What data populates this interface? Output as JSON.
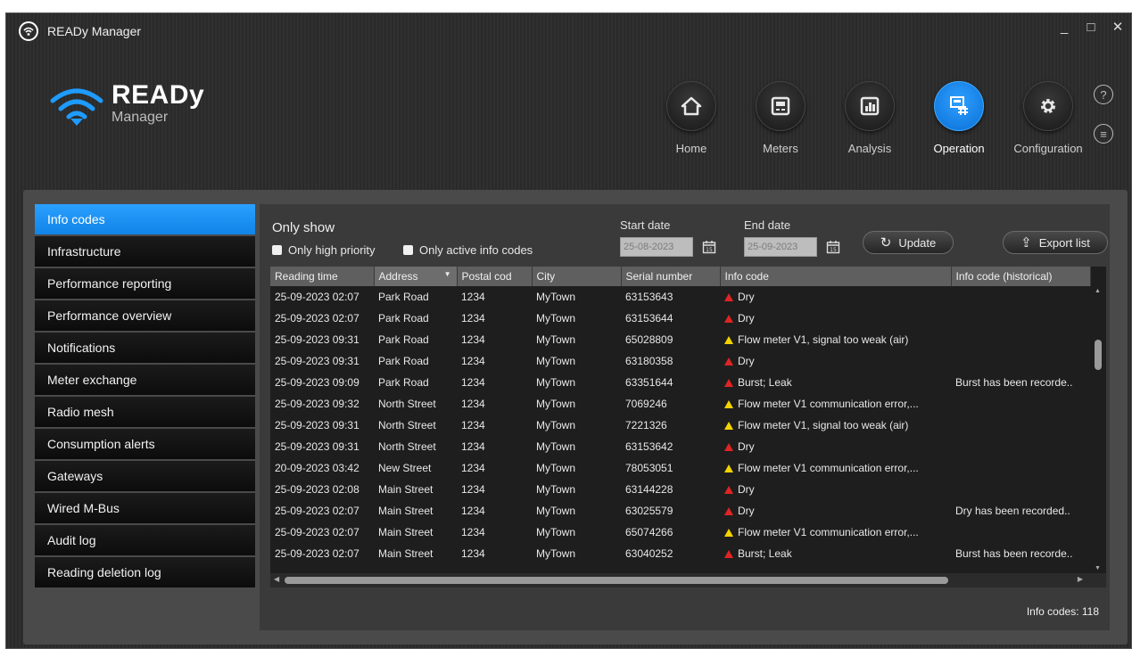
{
  "window": {
    "title": "READy Manager",
    "minimize": "_",
    "maximize": "□",
    "close": "✕"
  },
  "brand": {
    "name": "READy",
    "sub": "Manager"
  },
  "nav": [
    {
      "label": "Home",
      "icon": "home-icon"
    },
    {
      "label": "Meters",
      "icon": "meter-icon"
    },
    {
      "label": "Analysis",
      "icon": "analysis-icon"
    },
    {
      "label": "Operation",
      "icon": "operation-icon",
      "active": true
    },
    {
      "label": "Configuration",
      "icon": "gear-icon"
    }
  ],
  "help": {
    "help_glyph": "?",
    "info_glyph": "≡"
  },
  "sidebar": {
    "items": [
      {
        "label": "Info codes",
        "active": true
      },
      {
        "label": "Infrastructure"
      },
      {
        "label": "Performance reporting"
      },
      {
        "label": "Performance overview"
      },
      {
        "label": "Notifications"
      },
      {
        "label": "Meter exchange"
      },
      {
        "label": "Radio mesh"
      },
      {
        "label": "Consumption alerts"
      },
      {
        "label": "Gateways"
      },
      {
        "label": "Wired M-Bus"
      },
      {
        "label": "Audit log"
      },
      {
        "label": "Reading deletion log"
      }
    ]
  },
  "filters": {
    "title": "Only show",
    "high_priority": "Only high priority",
    "active_codes": "Only active info codes",
    "start_label": "Start date",
    "start_value": "25-08-2023",
    "end_label": "End date",
    "end_value": "25-09-2023",
    "update": "Update",
    "export": "Export list"
  },
  "table": {
    "columns": [
      "Reading time",
      "Address",
      "Postal cod",
      "City",
      "Serial number",
      "Info code",
      "Info code (historical)"
    ],
    "rows": [
      [
        "25-09-2023 02:07",
        "Park Road",
        "1234",
        "MyTown",
        "63153643",
        "Dry",
        "",
        "error"
      ],
      [
        "25-09-2023 02:07",
        "Park Road",
        "1234",
        "MyTown",
        "63153644",
        "Dry",
        "",
        "error"
      ],
      [
        "25-09-2023 09:31",
        "Park Road",
        "1234",
        "MyTown",
        "65028809",
        "Flow meter V1, signal too weak (air)",
        "",
        "warning"
      ],
      [
        "25-09-2023 09:31",
        "Park Road",
        "1234",
        "MyTown",
        "63180358",
        "Dry",
        "",
        "error"
      ],
      [
        "25-09-2023 09:09",
        "Park Road",
        "1234",
        "MyTown",
        "63351644",
        "Burst; Leak",
        "Burst has been recorde..",
        "error"
      ],
      [
        "25-09-2023 09:32",
        "North Street",
        "1234",
        "MyTown",
        "7069246",
        "Flow meter V1 communication error,...",
        "",
        "warning"
      ],
      [
        "25-09-2023 09:31",
        "North Street",
        "1234",
        "MyTown",
        "7221326",
        "Flow meter V1, signal too weak (air)",
        "",
        "warning"
      ],
      [
        "25-09-2023 09:31",
        "North Street",
        "1234",
        "MyTown",
        "63153642",
        "Dry",
        "",
        "error"
      ],
      [
        "20-09-2023 03:42",
        "New Street",
        "1234",
        "MyTown",
        "78053051",
        "Flow meter V1 communication error,...",
        "",
        "warning"
      ],
      [
        "25-09-2023 02:08",
        "Main Street",
        "1234",
        "MyTown",
        "63144228",
        "Dry",
        "",
        "error"
      ],
      [
        "25-09-2023 02:07",
        "Main Street",
        "1234",
        "MyTown",
        "63025579",
        "Dry",
        "Dry has been recorded..",
        "error"
      ],
      [
        "25-09-2023 02:07",
        "Main Street",
        "1234",
        "MyTown",
        "65074266",
        "Flow meter V1 communication error,...",
        "",
        "warning"
      ],
      [
        "25-09-2023 02:07",
        "Main Street",
        "1234",
        "MyTown",
        "63040252",
        "Burst; Leak",
        "Burst has been recorde..",
        "error"
      ]
    ]
  },
  "footer": {
    "count": "Info codes: 118"
  },
  "colors": {
    "accent": "#1589ee",
    "error": "#e02424",
    "warning": "#f5d300"
  }
}
